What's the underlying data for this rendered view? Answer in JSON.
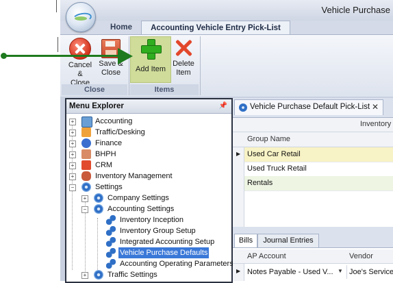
{
  "window_title": "Vehicle Purchase",
  "ribbon_tabs": [
    "Home",
    "Accounting Vehicle Entry Pick-List"
  ],
  "ribbon": {
    "cancel_close": "Cancel & Close",
    "save_close": "Save & Close",
    "add_item": "Add Item",
    "delete_item": "Delete Item",
    "group_close": "Close",
    "group_items": "Items"
  },
  "menu": {
    "title": "Menu Explorer",
    "pin_symbol": "📌",
    "items": [
      {
        "label": "Accounting",
        "icon": "accounting-icon"
      },
      {
        "label": "Traffic/Desking",
        "icon": "traffic-icon"
      },
      {
        "label": "Finance",
        "icon": "finance-icon"
      },
      {
        "label": "BHPH",
        "icon": "bhph-icon"
      },
      {
        "label": "CRM",
        "icon": "crm-icon"
      },
      {
        "label": "Inventory Management",
        "icon": "inventory-icon"
      },
      {
        "label": "Settings",
        "icon": "gear-icon"
      },
      {
        "label": "Company Settings",
        "icon": "gear-icon"
      },
      {
        "label": "Accounting Settings",
        "icon": "gear-icon"
      },
      {
        "label": "Inventory Inception",
        "icon": "chain-icon"
      },
      {
        "label": "Inventory Group Setup",
        "icon": "chain-icon"
      },
      {
        "label": "Integrated Accounting Setup",
        "icon": "chain-icon"
      },
      {
        "label": "Vehicle Purchase Defaults",
        "icon": "chain-icon"
      },
      {
        "label": "Accounting Operating Parameters",
        "icon": "chain-icon"
      },
      {
        "label": "Traffic Settings",
        "icon": "gear-icon"
      }
    ]
  },
  "document_tab": "Vehicle Purchase Default Pick-List",
  "grid": {
    "band_header": "Inventory",
    "column_header": "Group Name",
    "rows": [
      "Used Car Retail",
      "Used Truck Retail",
      "Rentals"
    ]
  },
  "subtabs": [
    "Bills",
    "Journal Entries"
  ],
  "bills_grid": {
    "columns": [
      "AP Account",
      "Vendor"
    ],
    "row": {
      "ap_account": "Notes Payable - Used V...",
      "vendor": "Joe's Service"
    }
  },
  "colors": {
    "highlight": "#cfdc9a",
    "selection": "#3a78d8",
    "pointer": "#1e7a1e"
  }
}
